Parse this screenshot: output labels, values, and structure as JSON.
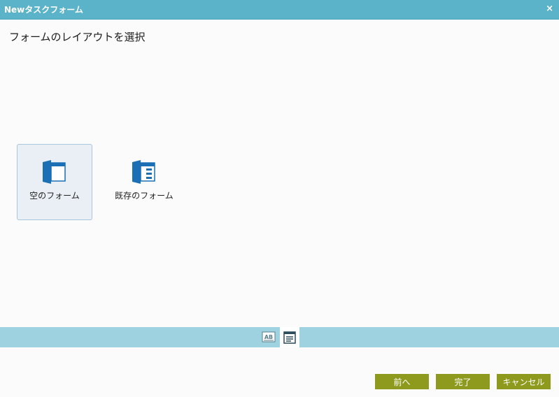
{
  "dialog": {
    "title": "Newタスクフォーム",
    "close_label": "×"
  },
  "main": {
    "heading": "フォームのレイアウトを選択",
    "options": [
      {
        "label": "空のフォーム",
        "icon": "blank-form-icon",
        "selected": true
      },
      {
        "label": "既存のフォーム",
        "icon": "existing-form-icon",
        "selected": false
      }
    ]
  },
  "toolbar": {
    "buttons": [
      {
        "icon": "text-ab-icon",
        "active": false
      },
      {
        "icon": "form-layout-icon",
        "active": true
      }
    ]
  },
  "footer": {
    "back_label": "前へ",
    "finish_label": "完了",
    "cancel_label": "キャンセル"
  },
  "colors": {
    "titlebar": "#5bb3c9",
    "toolbar": "#9fd2e0",
    "button": "#8e9a1d",
    "icon_blue": "#1a6fb5",
    "selected_bg": "#e9eff4"
  }
}
